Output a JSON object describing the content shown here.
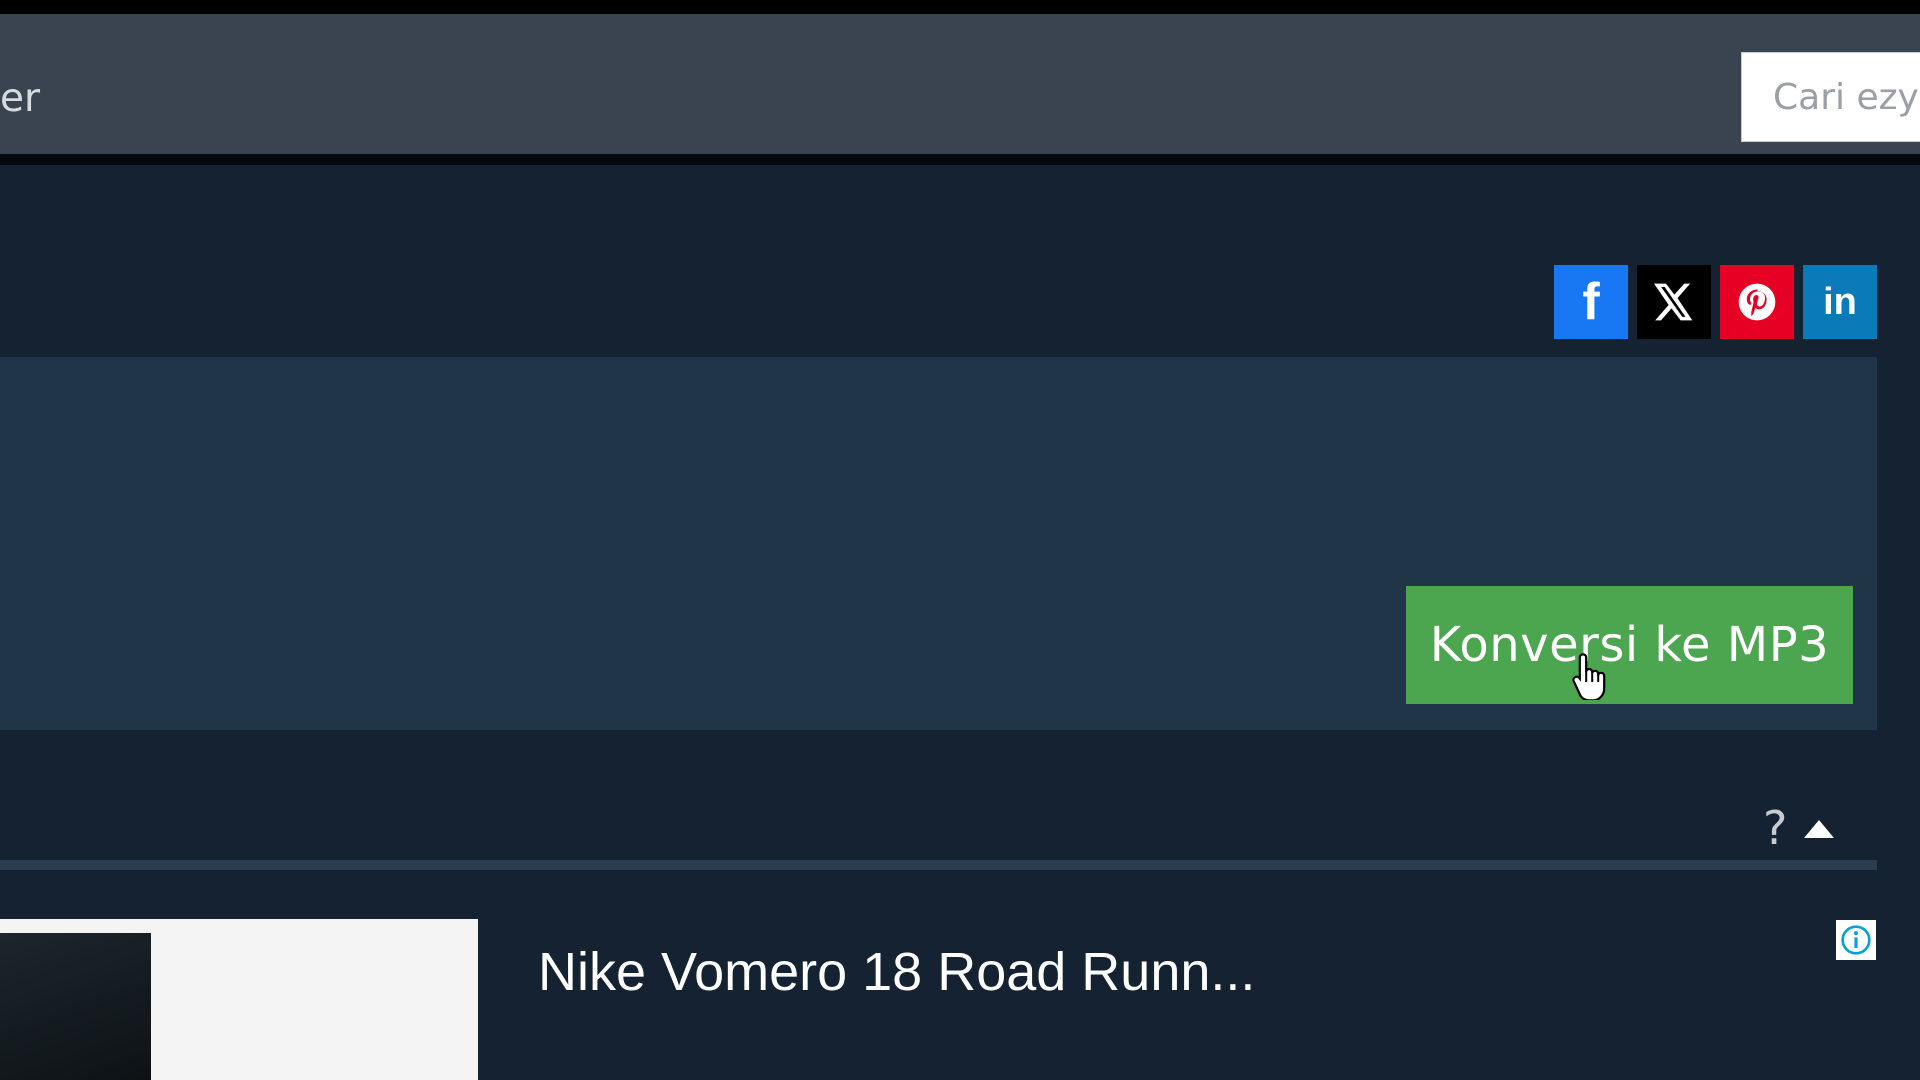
{
  "header": {
    "nav_label": "er",
    "search_placeholder": "Cari ezyZip"
  },
  "social": {
    "facebook_label": "f",
    "linkedin_label": "in",
    "colors": {
      "facebook": "#1877f2",
      "x": "#000000",
      "pinterest": "#e60023",
      "linkedin": "#0a7ab8"
    }
  },
  "main": {
    "convert_button_label": "Konversi ke MP3",
    "accent_color": "#4ca54f"
  },
  "help": {
    "question_label": "?",
    "toggle_icon": "caret-up-icon"
  },
  "ad": {
    "title": "Nike Vomero 18 Road Runn...",
    "info_icon": "info-icon"
  }
}
